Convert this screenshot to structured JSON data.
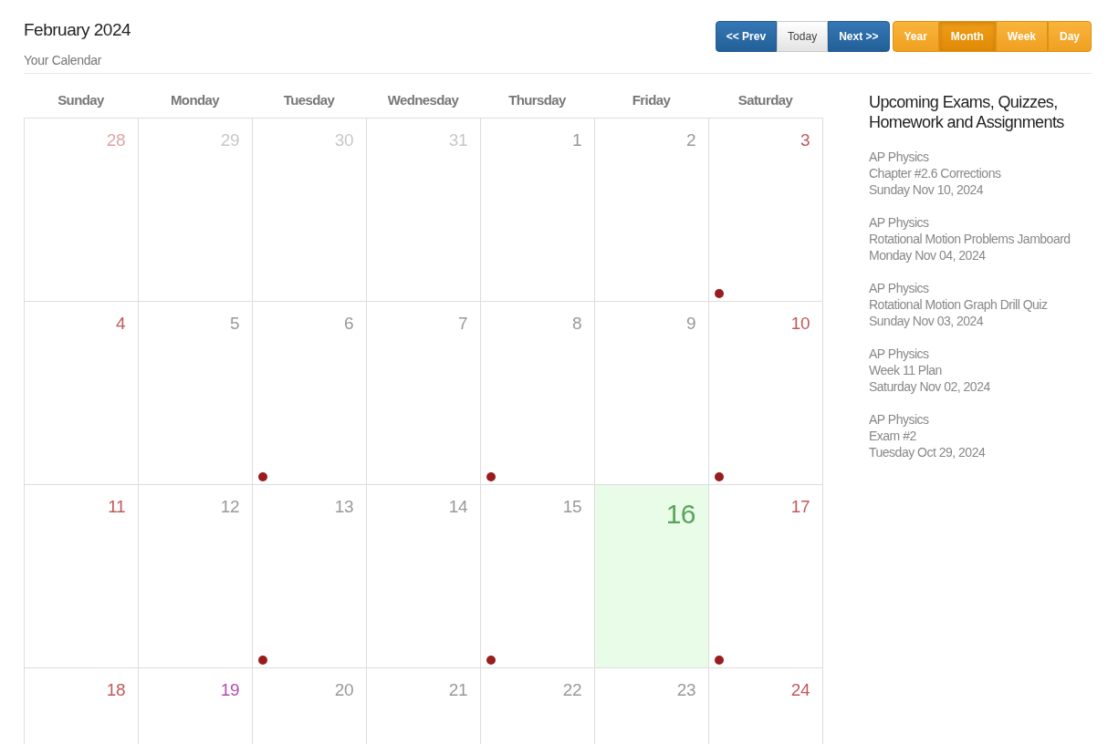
{
  "header": {
    "title": "February 2024",
    "subtitle": "Your Calendar"
  },
  "nav_buttons": [
    {
      "label": "<< Prev",
      "kind": "primary"
    },
    {
      "label": "Today",
      "kind": "default"
    },
    {
      "label": "Next >>",
      "kind": "primary"
    }
  ],
  "view_tabs": [
    {
      "label": "Year",
      "selected": false
    },
    {
      "label": "Month",
      "selected": true
    },
    {
      "label": "Week",
      "selected": false
    },
    {
      "label": "Day",
      "selected": false
    }
  ],
  "weekdays": [
    "Sunday",
    "Monday",
    "Tuesday",
    "Wednesday",
    "Thursday",
    "Friday",
    "Saturday"
  ],
  "weeks": [
    [
      {
        "day": "28",
        "kind": "weekend",
        "other_month": true,
        "today": false,
        "event": false
      },
      {
        "day": "29",
        "kind": "weekday",
        "other_month": true,
        "today": false,
        "event": false
      },
      {
        "day": "30",
        "kind": "weekday",
        "other_month": true,
        "today": false,
        "event": false
      },
      {
        "day": "31",
        "kind": "weekday",
        "other_month": true,
        "today": false,
        "event": false
      },
      {
        "day": "1",
        "kind": "weekday",
        "other_month": false,
        "today": false,
        "event": false
      },
      {
        "day": "2",
        "kind": "weekday",
        "other_month": false,
        "today": false,
        "event": false
      },
      {
        "day": "3",
        "kind": "weekend",
        "other_month": false,
        "today": false,
        "event": true
      }
    ],
    [
      {
        "day": "4",
        "kind": "weekend",
        "other_month": false,
        "today": false,
        "event": false
      },
      {
        "day": "5",
        "kind": "weekday",
        "other_month": false,
        "today": false,
        "event": false
      },
      {
        "day": "6",
        "kind": "weekday",
        "other_month": false,
        "today": false,
        "event": true
      },
      {
        "day": "7",
        "kind": "weekday",
        "other_month": false,
        "today": false,
        "event": false
      },
      {
        "day": "8",
        "kind": "weekday",
        "other_month": false,
        "today": false,
        "event": true
      },
      {
        "day": "9",
        "kind": "weekday",
        "other_month": false,
        "today": false,
        "event": false
      },
      {
        "day": "10",
        "kind": "weekend",
        "other_month": false,
        "today": false,
        "event": true
      }
    ],
    [
      {
        "day": "11",
        "kind": "weekend",
        "other_month": false,
        "today": false,
        "event": false
      },
      {
        "day": "12",
        "kind": "weekday",
        "other_month": false,
        "today": false,
        "event": false
      },
      {
        "day": "13",
        "kind": "weekday",
        "other_month": false,
        "today": false,
        "event": true
      },
      {
        "day": "14",
        "kind": "weekday",
        "other_month": false,
        "today": false,
        "event": false
      },
      {
        "day": "15",
        "kind": "weekday",
        "other_month": false,
        "today": false,
        "event": true
      },
      {
        "day": "16",
        "kind": "weekday",
        "other_month": false,
        "today": true,
        "event": false
      },
      {
        "day": "17",
        "kind": "weekend",
        "other_month": false,
        "today": false,
        "event": true
      }
    ],
    [
      {
        "day": "18",
        "kind": "weekend",
        "other_month": false,
        "today": false,
        "event": false
      },
      {
        "day": "19",
        "kind": "holiday",
        "other_month": false,
        "today": false,
        "event": false
      },
      {
        "day": "20",
        "kind": "weekday",
        "other_month": false,
        "today": false,
        "event": false
      },
      {
        "day": "21",
        "kind": "weekday",
        "other_month": false,
        "today": false,
        "event": false
      },
      {
        "day": "22",
        "kind": "weekday",
        "other_month": false,
        "today": false,
        "event": false
      },
      {
        "day": "23",
        "kind": "weekday",
        "other_month": false,
        "today": false,
        "event": false
      },
      {
        "day": "24",
        "kind": "weekend",
        "other_month": false,
        "today": false,
        "event": false
      }
    ]
  ],
  "upcoming": {
    "title": "Upcoming Exams, Quizzes, Homework and Assignments",
    "items": [
      {
        "course": "AP Physics",
        "name": "Chapter #2.6 Corrections",
        "date": "Sunday Nov 10, 2024"
      },
      {
        "course": "AP Physics",
        "name": "Rotational Motion Problems Jamboard",
        "date": "Monday Nov 04, 2024"
      },
      {
        "course": "AP Physics",
        "name": "Rotational Motion Graph Drill Quiz",
        "date": "Sunday Nov 03, 2024"
      },
      {
        "course": "AP Physics",
        "name": "Week 11 Plan",
        "date": "Saturday Nov 02, 2024"
      },
      {
        "course": "AP Physics",
        "name": "Exam #2",
        "date": "Tuesday Oct 29, 2024"
      }
    ]
  }
}
